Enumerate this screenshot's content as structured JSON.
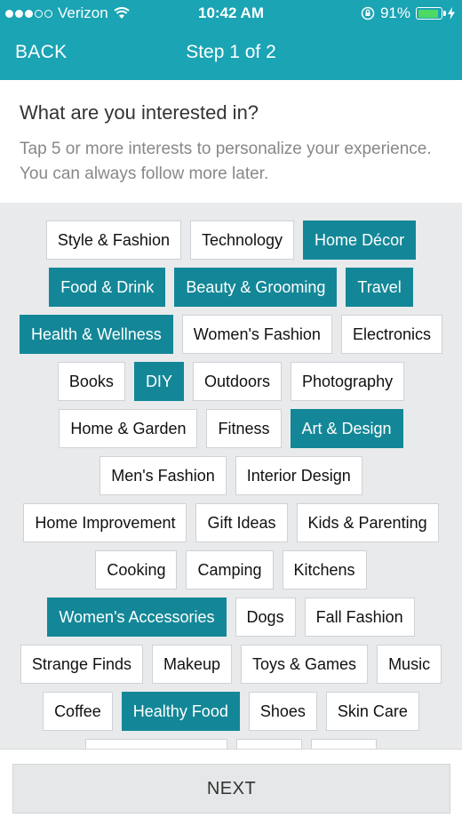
{
  "status_bar": {
    "carrier": "Verizon",
    "time": "10:42 AM",
    "battery": "91%",
    "battery_level": 0.91,
    "signal_bars": 3,
    "icons": [
      "wifi-icon",
      "orientation-lock-icon",
      "battery-icon",
      "charging-bolt-icon"
    ]
  },
  "nav": {
    "back_label": "BACK",
    "title": "Step 1 of 2"
  },
  "header": {
    "title": "What are you interested in?",
    "subtitle": "Tap 5 or more interests to personalize your experience. You can always follow more later."
  },
  "interests": [
    [
      {
        "label": "Style & Fashion",
        "selected": false
      },
      {
        "label": "Technology",
        "selected": false
      },
      {
        "label": "Home Décor",
        "selected": true
      }
    ],
    [
      {
        "label": "Food & Drink",
        "selected": true
      },
      {
        "label": "Beauty & Grooming",
        "selected": true
      },
      {
        "label": "Travel",
        "selected": true
      }
    ],
    [
      {
        "label": "Health & Wellness",
        "selected": true
      },
      {
        "label": "Women's Fashion",
        "selected": false
      },
      {
        "label": "Electronics",
        "selected": false
      }
    ],
    [
      {
        "label": "Books",
        "selected": false
      },
      {
        "label": "DIY",
        "selected": true
      },
      {
        "label": "Outdoors",
        "selected": false
      },
      {
        "label": "Photography",
        "selected": false
      }
    ],
    [
      {
        "label": "Home & Garden",
        "selected": false
      },
      {
        "label": "Fitness",
        "selected": false
      },
      {
        "label": "Art & Design",
        "selected": true
      }
    ],
    [
      {
        "label": "Men's Fashion",
        "selected": false
      },
      {
        "label": "Interior Design",
        "selected": false
      }
    ],
    [
      {
        "label": "Home Improvement",
        "selected": false
      },
      {
        "label": "Gift Ideas",
        "selected": false
      },
      {
        "label": "Kids & Parenting",
        "selected": false
      }
    ],
    [
      {
        "label": "Cooking",
        "selected": false
      },
      {
        "label": "Camping",
        "selected": false
      },
      {
        "label": "Kitchens",
        "selected": false
      }
    ],
    [
      {
        "label": "Women's Accessories",
        "selected": true
      },
      {
        "label": "Dogs",
        "selected": false
      },
      {
        "label": "Fall Fashion",
        "selected": false
      }
    ],
    [
      {
        "label": "Strange Finds",
        "selected": false
      },
      {
        "label": "Makeup",
        "selected": false
      },
      {
        "label": "Toys & Games",
        "selected": false
      },
      {
        "label": "Music",
        "selected": false
      }
    ],
    [
      {
        "label": "Coffee",
        "selected": false
      },
      {
        "label": "Healthy Food",
        "selected": true
      },
      {
        "label": "Shoes",
        "selected": false
      },
      {
        "label": "Skin Care",
        "selected": false
      }
    ],
    [
      {
        "label": "",
        "selected": false
      },
      {
        "label": "",
        "selected": false
      },
      {
        "label": "",
        "selected": false
      }
    ]
  ],
  "footer": {
    "next_label": "NEXT"
  },
  "colors": {
    "brand": "#1aa4b4",
    "selected": "#138797",
    "battery": "#4cd964"
  }
}
